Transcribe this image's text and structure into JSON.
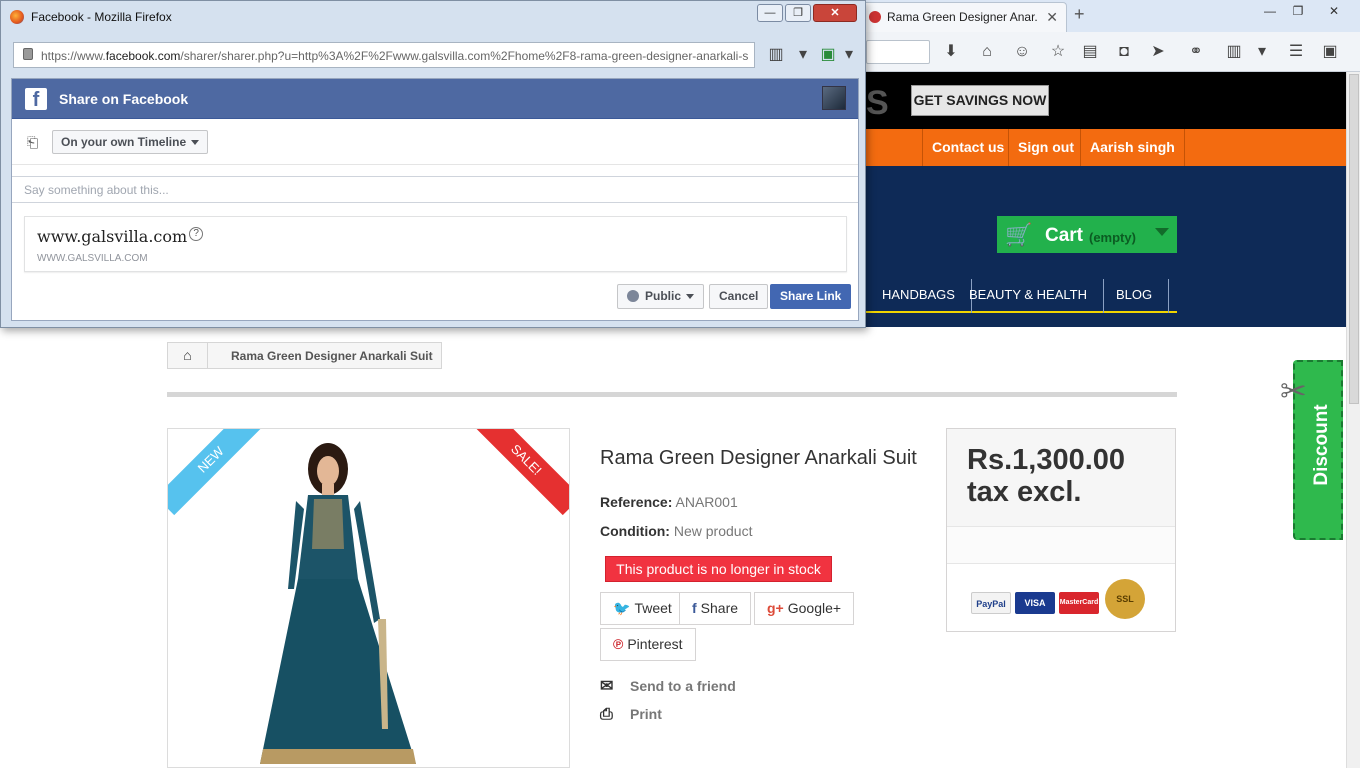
{
  "browser": {
    "tab_title": "Rama Green Designer Anar...",
    "new_tab": "+",
    "tab_close": "✕",
    "win_min": "—",
    "win_max": "❐",
    "win_close": "✕"
  },
  "site": {
    "logo_fragment": "S",
    "savings_button": "GET SAVINGS NOW",
    "user_links": [
      "Contact us",
      "Sign out",
      "Aarish singh"
    ],
    "cart": {
      "label": "Cart",
      "qty": "(empty)"
    },
    "menu": [
      "HANDBAGS",
      "BEAUTY & HEALTH",
      "BLOG"
    ],
    "breadcrumb": "Rama Green Designer Anarkali Suit",
    "discount_tab": "Discount"
  },
  "product": {
    "ribbon_new": "NEW",
    "ribbon_sale": "SALE!",
    "title": "Rama Green Designer Anarkali Suit",
    "reference_label": "Reference:",
    "reference": "ANAR001",
    "condition_label": "Condition:",
    "condition": "New product",
    "stock_badge": "This product is no longer in stock",
    "share_buttons": [
      "Tweet",
      "Share",
      "Google+",
      "Pinterest"
    ],
    "send_friend": "Send to a friend",
    "print": "Print",
    "price_line1": "Rs.1,300.00",
    "price_line2": "tax excl.",
    "payment_logos": [
      "PayPal",
      "VISA",
      "MasterCard",
      "SSL"
    ]
  },
  "popup": {
    "window_title": "Facebook - Mozilla Firefox",
    "url_prefix": "https://www.",
    "url_host": "facebook.com",
    "url_rest": "/sharer/sharer.php?u=http%3A%2F%2Fwww.galsvilla.com%2Fhome%2F8-rama-green-designer-anarkali-s",
    "header_title": "Share on Facebook",
    "audience_select": "On your own Timeline",
    "say_placeholder": "Say something about this...",
    "link_title": "www.galsvilla.com",
    "link_host": "WWW.GALSVILLA.COM",
    "public_button": "Public",
    "cancel_button": "Cancel",
    "share_button": "Share Link"
  },
  "colors": {
    "facebook_blue": "#4e69a2",
    "site_orange": "#f36b10",
    "site_navy": "#0e2a57",
    "cart_green": "#22b14c",
    "stock_red": "#f13340"
  }
}
